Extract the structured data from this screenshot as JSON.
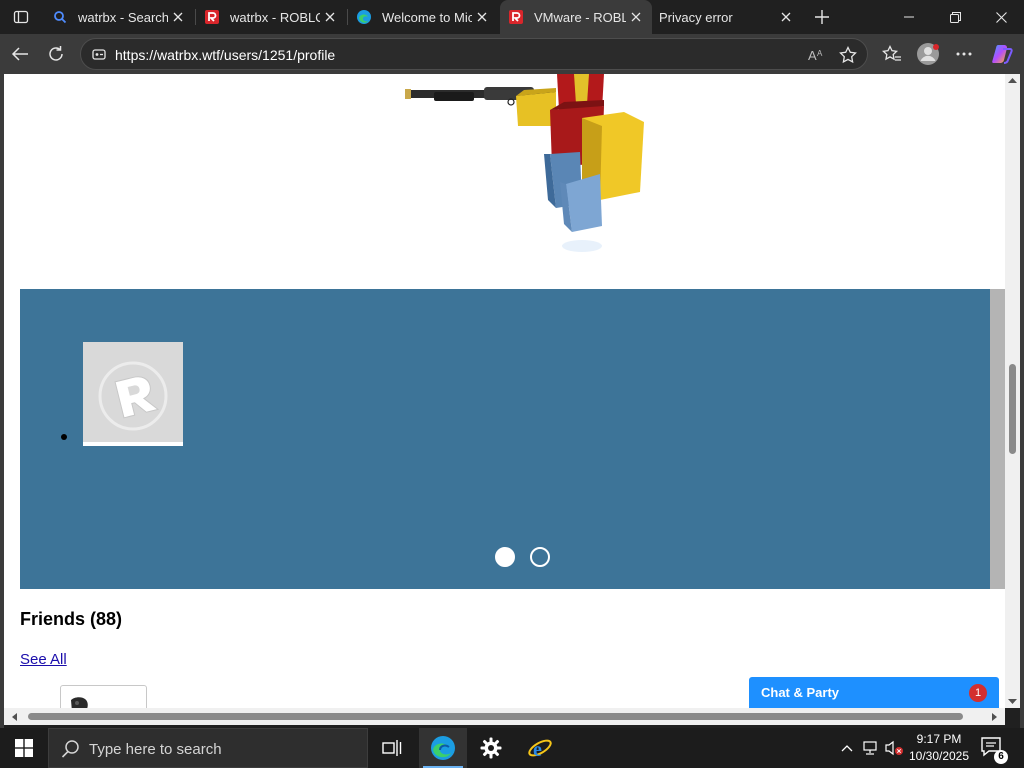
{
  "browser": {
    "tabs": [
      {
        "title": "watrbx - Search",
        "favicon": "bing-search-icon"
      },
      {
        "title": "watrbx - ROBLOX",
        "favicon": "roblox-icon"
      },
      {
        "title": "Welcome to Micr",
        "favicon": "edge-icon"
      },
      {
        "title": "VMware - ROBLO",
        "favicon": "roblox-icon"
      },
      {
        "title": "Privacy error",
        "favicon": ""
      }
    ],
    "active_tab_index": 3,
    "url": "https://watrbx.wtf/users/1251/profile"
  },
  "page": {
    "carousel": {
      "slides": 2,
      "active_slide": 0,
      "tile_logo": "R"
    },
    "friends": {
      "heading": "Friends (88)",
      "see_all": "See All"
    },
    "chat": {
      "label": "Chat & Party",
      "badge": "1"
    }
  },
  "taskbar": {
    "search_placeholder": "Type here to search",
    "time": "9:17 PM",
    "date": "10/30/2025",
    "notification_count": "6"
  },
  "colors": {
    "carousel_bg": "#3d7498",
    "chat_bg": "#1e90ff",
    "link": "#1a0dab",
    "browser_chrome": "#3b3b3b"
  }
}
